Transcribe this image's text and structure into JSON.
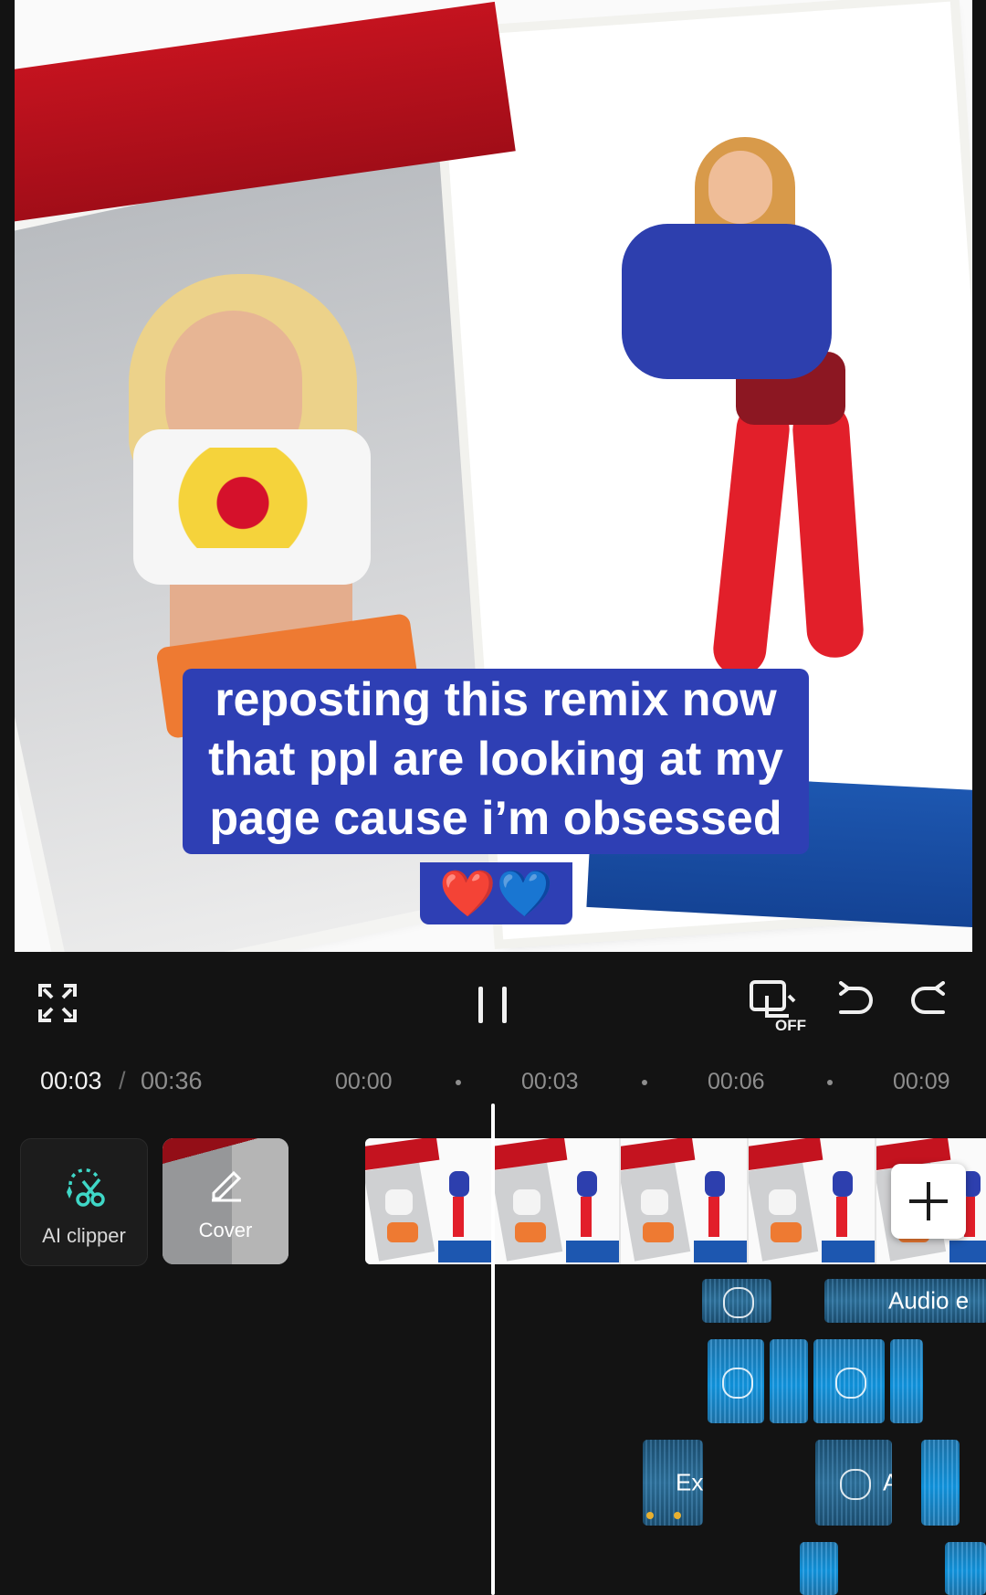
{
  "preview": {
    "caption_lines": [
      "reposting this remix now",
      "that ppl are looking at my",
      "page cause i’m obsessed"
    ],
    "caption_emoji": "❤️💙"
  },
  "controls": {
    "fullscreen_icon": "expand-icon",
    "play_state_icon": "pause-icon",
    "keyframe_icon": "keyframe-off-icon",
    "keyframe_state": "OFF",
    "undo_icon": "undo-icon",
    "redo_icon": "redo-icon"
  },
  "timeline": {
    "current_time": "00:03",
    "separator": "/",
    "total_time": "00:36",
    "ruler": [
      "00:00",
      "00:03",
      "00:06",
      "00:09"
    ]
  },
  "tools": {
    "ai_clipper_label": "AI clipper",
    "cover_label": "Cover"
  },
  "audio_clips": {
    "top_right_label": "Audio e",
    "extract_label": "Ex",
    "row3_label": "A"
  },
  "colors": {
    "caption_bg": "#2e3fb4",
    "audio_accent": "#0f8fd6",
    "background": "#131313"
  }
}
